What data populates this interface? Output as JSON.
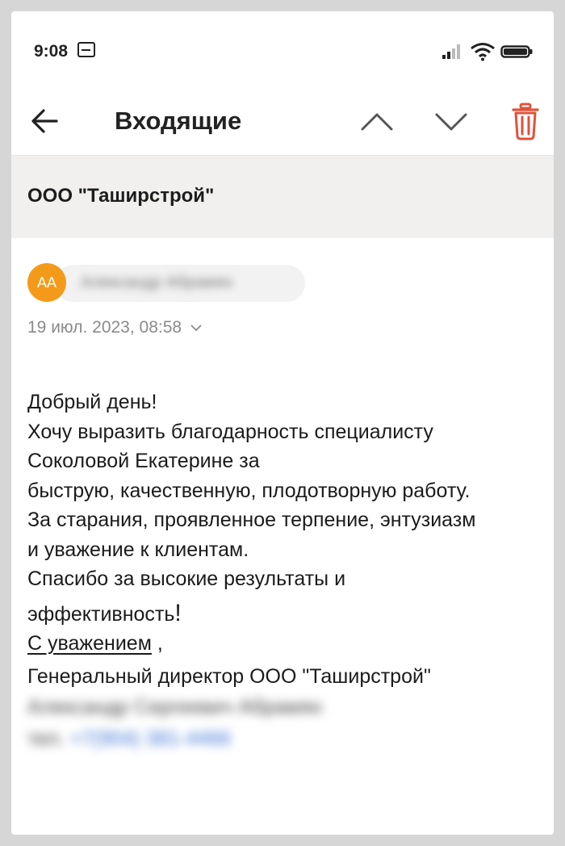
{
  "status_bar": {
    "time": "9:08",
    "icons": [
      "mail-notification-icon",
      "signal-icon",
      "wifi-icon",
      "battery-icon"
    ]
  },
  "toolbar": {
    "title": "Входящие",
    "back_icon": "arrow-left-icon",
    "prev_icon": "chevron-up-icon",
    "next_icon": "chevron-down-icon",
    "delete_icon": "trash-icon",
    "delete_color": "#e0523b"
  },
  "email": {
    "subject": "ООО \"Таширстрой\"",
    "sender": {
      "initials": "АА",
      "avatar_color": "#f49a1b",
      "name": "Александр Абрамян"
    },
    "date": "19 июл. 2023, 08:58",
    "body": {
      "line1": "Добрый день!",
      "line2": "Хочу выразить благодарность специалисту",
      "line3": "Соколовой Екатерине за",
      "line4": "быструю, качественную, плодотворную работу.",
      "line5": "За старания, проявленное терпение, энтузиазм",
      "line6": "и уважение к клиентам.",
      "line7": "Спасибо за высокие результаты и",
      "line8": "эффективность",
      "line8_end": "!",
      "closing": "С уважением",
      "closing_comma": " ,",
      "signature_title": "Генеральный директор ООО \"Таширстрой\"",
      "signature_name": "Александр Сергеевич Абрамян",
      "phone_prefix": "тел.",
      "phone": "+7(904) 381-4466"
    }
  }
}
